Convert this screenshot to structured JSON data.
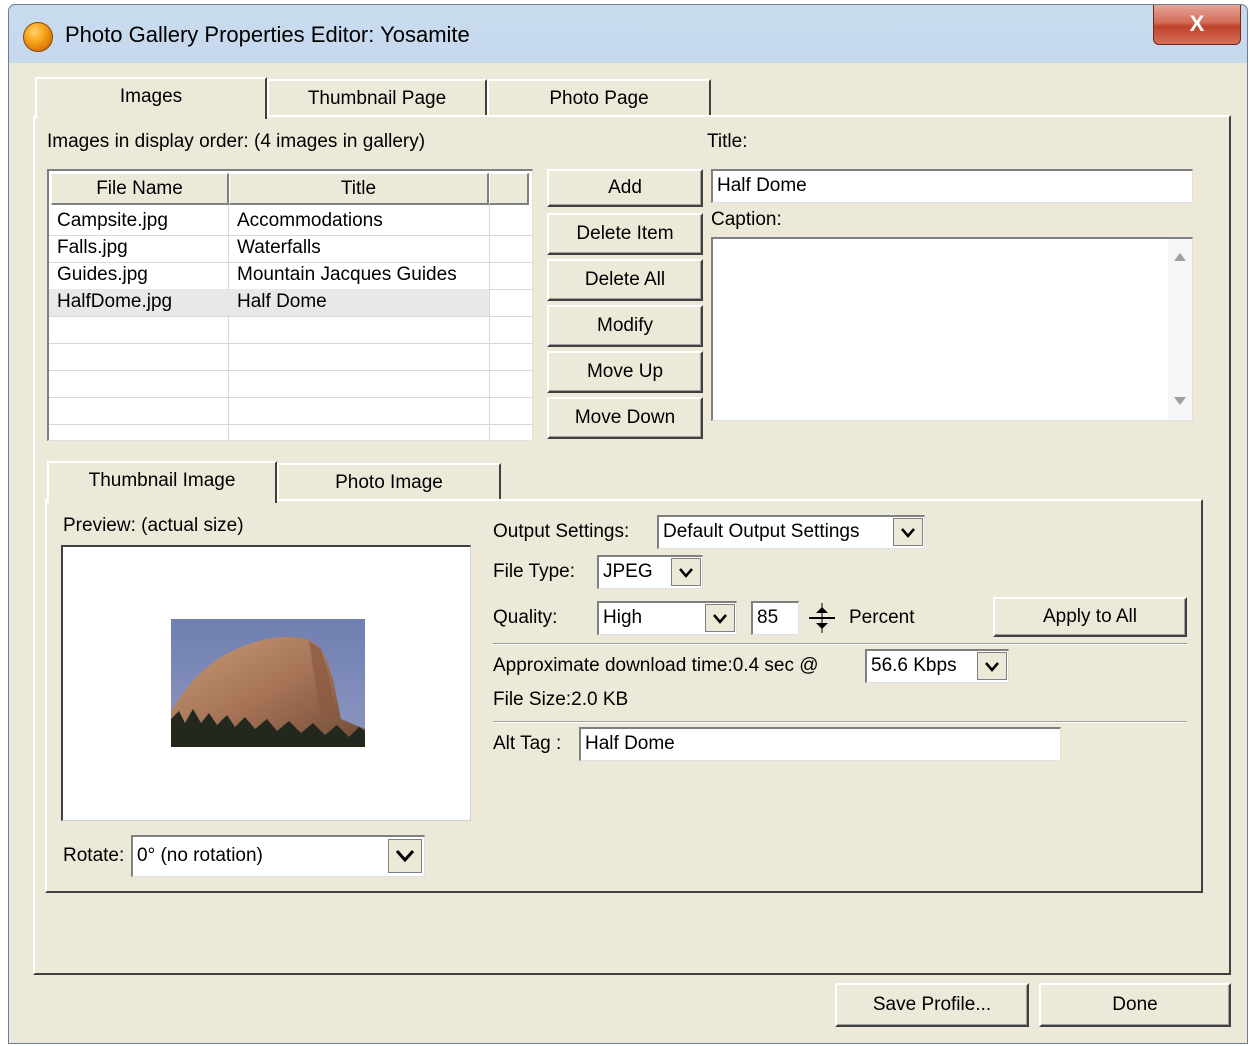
{
  "window": {
    "title": "Photo Gallery Properties Editor: Yosamite",
    "close_glyph": "X"
  },
  "main_tabs": [
    {
      "label": "Images",
      "active": true
    },
    {
      "label": "Thumbnail Page",
      "active": false
    },
    {
      "label": "Photo Page",
      "active": false
    }
  ],
  "images_panel": {
    "list_label": "Images in display order: (4  images in gallery)",
    "columns": [
      "File Name",
      "Title"
    ],
    "rows": [
      {
        "file": "Campsite.jpg",
        "title": "Accommodations",
        "selected": false
      },
      {
        "file": "Falls.jpg",
        "title": "Waterfalls",
        "selected": false
      },
      {
        "file": "Guides.jpg",
        "title": "Mountain Jacques Guides",
        "selected": false
      },
      {
        "file": "HalfDome.jpg",
        "title": "Half Dome",
        "selected": true
      }
    ],
    "buttons": {
      "add": "Add",
      "delete_item": "Delete Item",
      "delete_all": "Delete All",
      "modify": "Modify",
      "move_up": "Move Up",
      "move_down": "Move Down"
    },
    "title_label": "Title:",
    "title_value": "Half Dome",
    "caption_label": "Caption:",
    "caption_value": ""
  },
  "sub_tabs": [
    {
      "label": "Thumbnail Image",
      "active": true
    },
    {
      "label": "Photo Image",
      "active": false
    }
  ],
  "thumbnail": {
    "preview_label": "Preview: (actual size)",
    "rotate_label": "Rotate:",
    "rotate_value": "0° (no rotation)",
    "output_settings_label": "Output Settings:",
    "output_settings_value": "Default Output Settings",
    "file_type_label": "File Type:",
    "file_type_value": "JPEG",
    "quality_label": "Quality:",
    "quality_value": "High",
    "quality_number": "85",
    "percent_label": "Percent",
    "apply_to_all": "Apply to All",
    "download_label": "Approximate download time:0.4 sec @",
    "download_speed": "56.6 Kbps",
    "file_size": "File Size:2.0 KB",
    "alt_tag_label": "Alt Tag :",
    "alt_tag_value": "Half Dome"
  },
  "footer": {
    "save_profile": "Save Profile...",
    "done": "Done"
  },
  "icons": {
    "app": "orange-sphere-icon",
    "dropdown": "chevron-down-icon",
    "spinner": "spinner-arrows-icon",
    "scroll_up": "scroll-up-arrow-icon",
    "scroll_down": "scroll-down-arrow-icon"
  }
}
